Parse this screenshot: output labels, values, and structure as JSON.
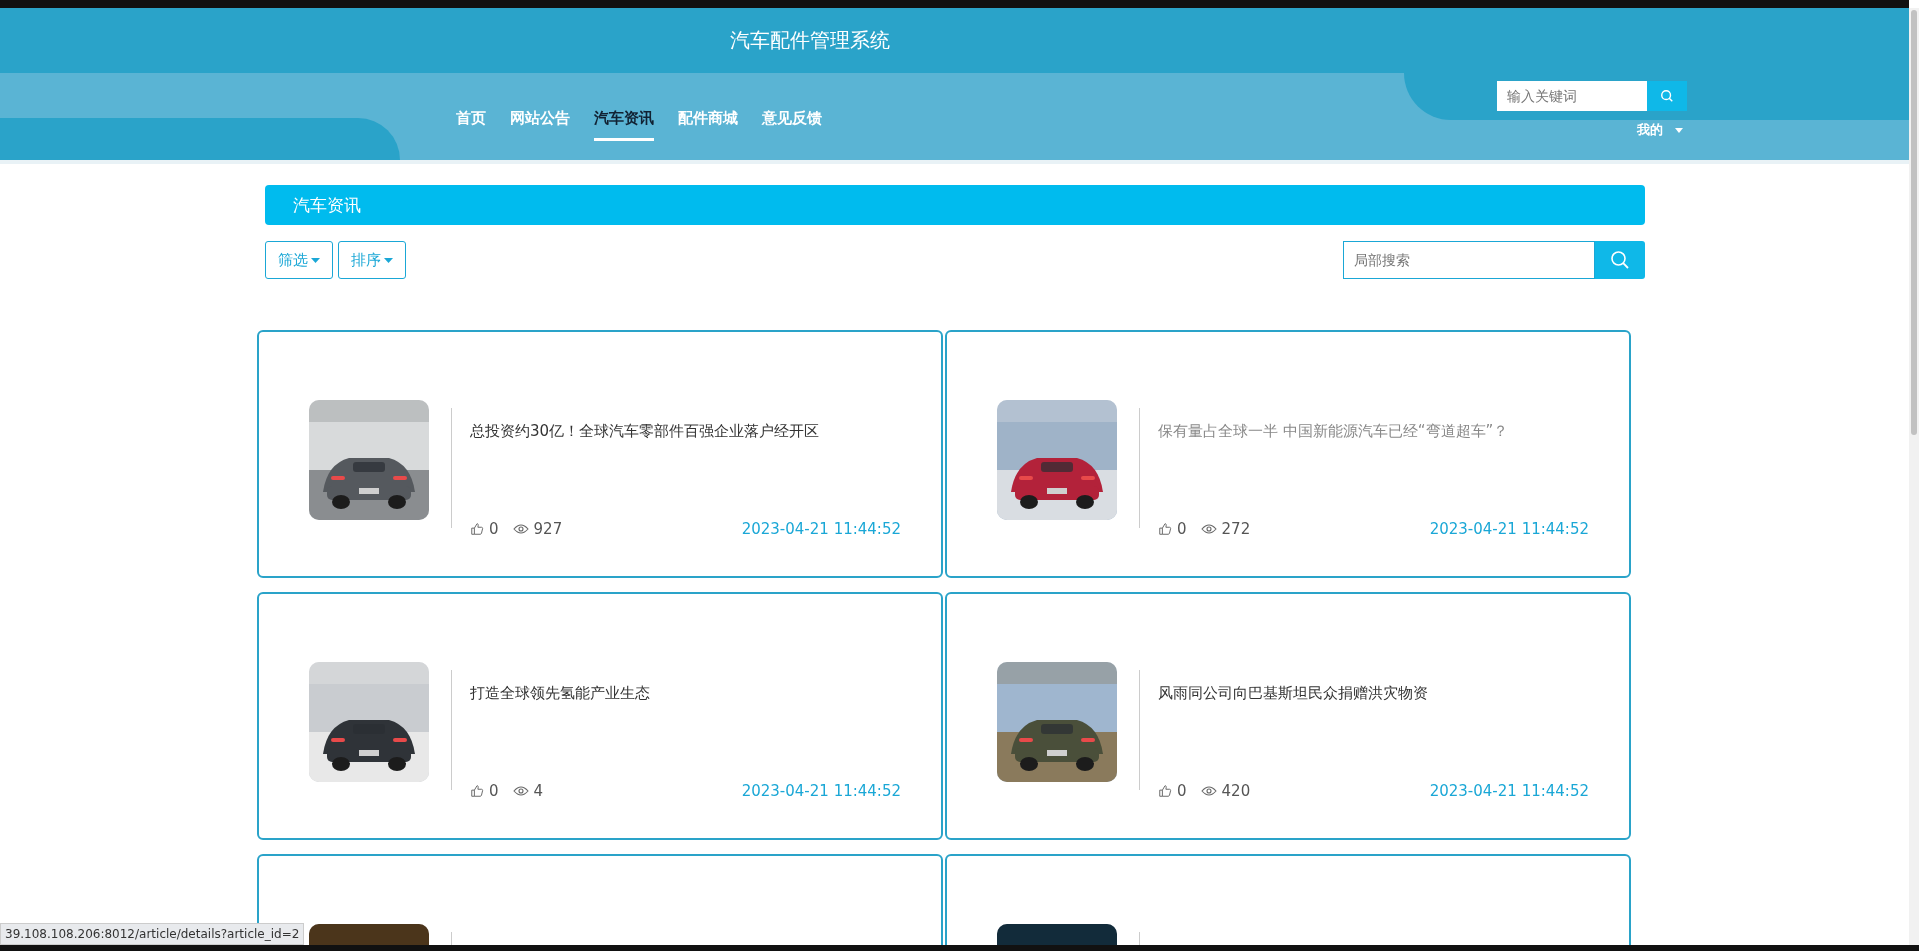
{
  "header": {
    "title": "汽车配件管理系统",
    "search": {
      "placeholder": "输入关键词"
    },
    "user_menu": "我的"
  },
  "nav": [
    {
      "label": "首页",
      "selected": false
    },
    {
      "label": "网站公告",
      "selected": false
    },
    {
      "label": "汽车资讯",
      "selected": true
    },
    {
      "label": "配件商城",
      "selected": false
    },
    {
      "label": "意见反馈",
      "selected": false
    }
  ],
  "section": {
    "title": "汽车资讯",
    "filters": [
      "筛选",
      "排序"
    ],
    "search": {
      "placeholder": "局部搜索"
    }
  },
  "articles": [
    {
      "kind": "article",
      "title": "总投资约30亿！全球汽车零部件百强企业落户经开区",
      "likes": "0",
      "views": "927",
      "date": "2023-04-21 11:44:52",
      "hovered": false
    },
    {
      "kind": "article",
      "title": "保有量占全球一半 中国新能源汽车已经“弯道超车”？",
      "likes": "0",
      "views": "272",
      "date": "2023-04-21 11:44:52",
      "hovered": true
    },
    {
      "kind": "article",
      "title": "打造全球领先氢能产业生态",
      "likes": "0",
      "views": "4",
      "date": "2023-04-21 11:44:52",
      "hovered": false
    },
    {
      "kind": "article",
      "title": "风雨同公司向巴基斯坦民众捐赠洪灾物资",
      "likes": "0",
      "views": "420",
      "date": "2023-04-21 11:44:52",
      "hovered": false
    },
    {
      "kind": "picture"
    },
    {
      "kind": "picture"
    }
  ],
  "status_bar": {
    "url": "39.108.108.206:8012/article/details?article_id=2"
  }
}
